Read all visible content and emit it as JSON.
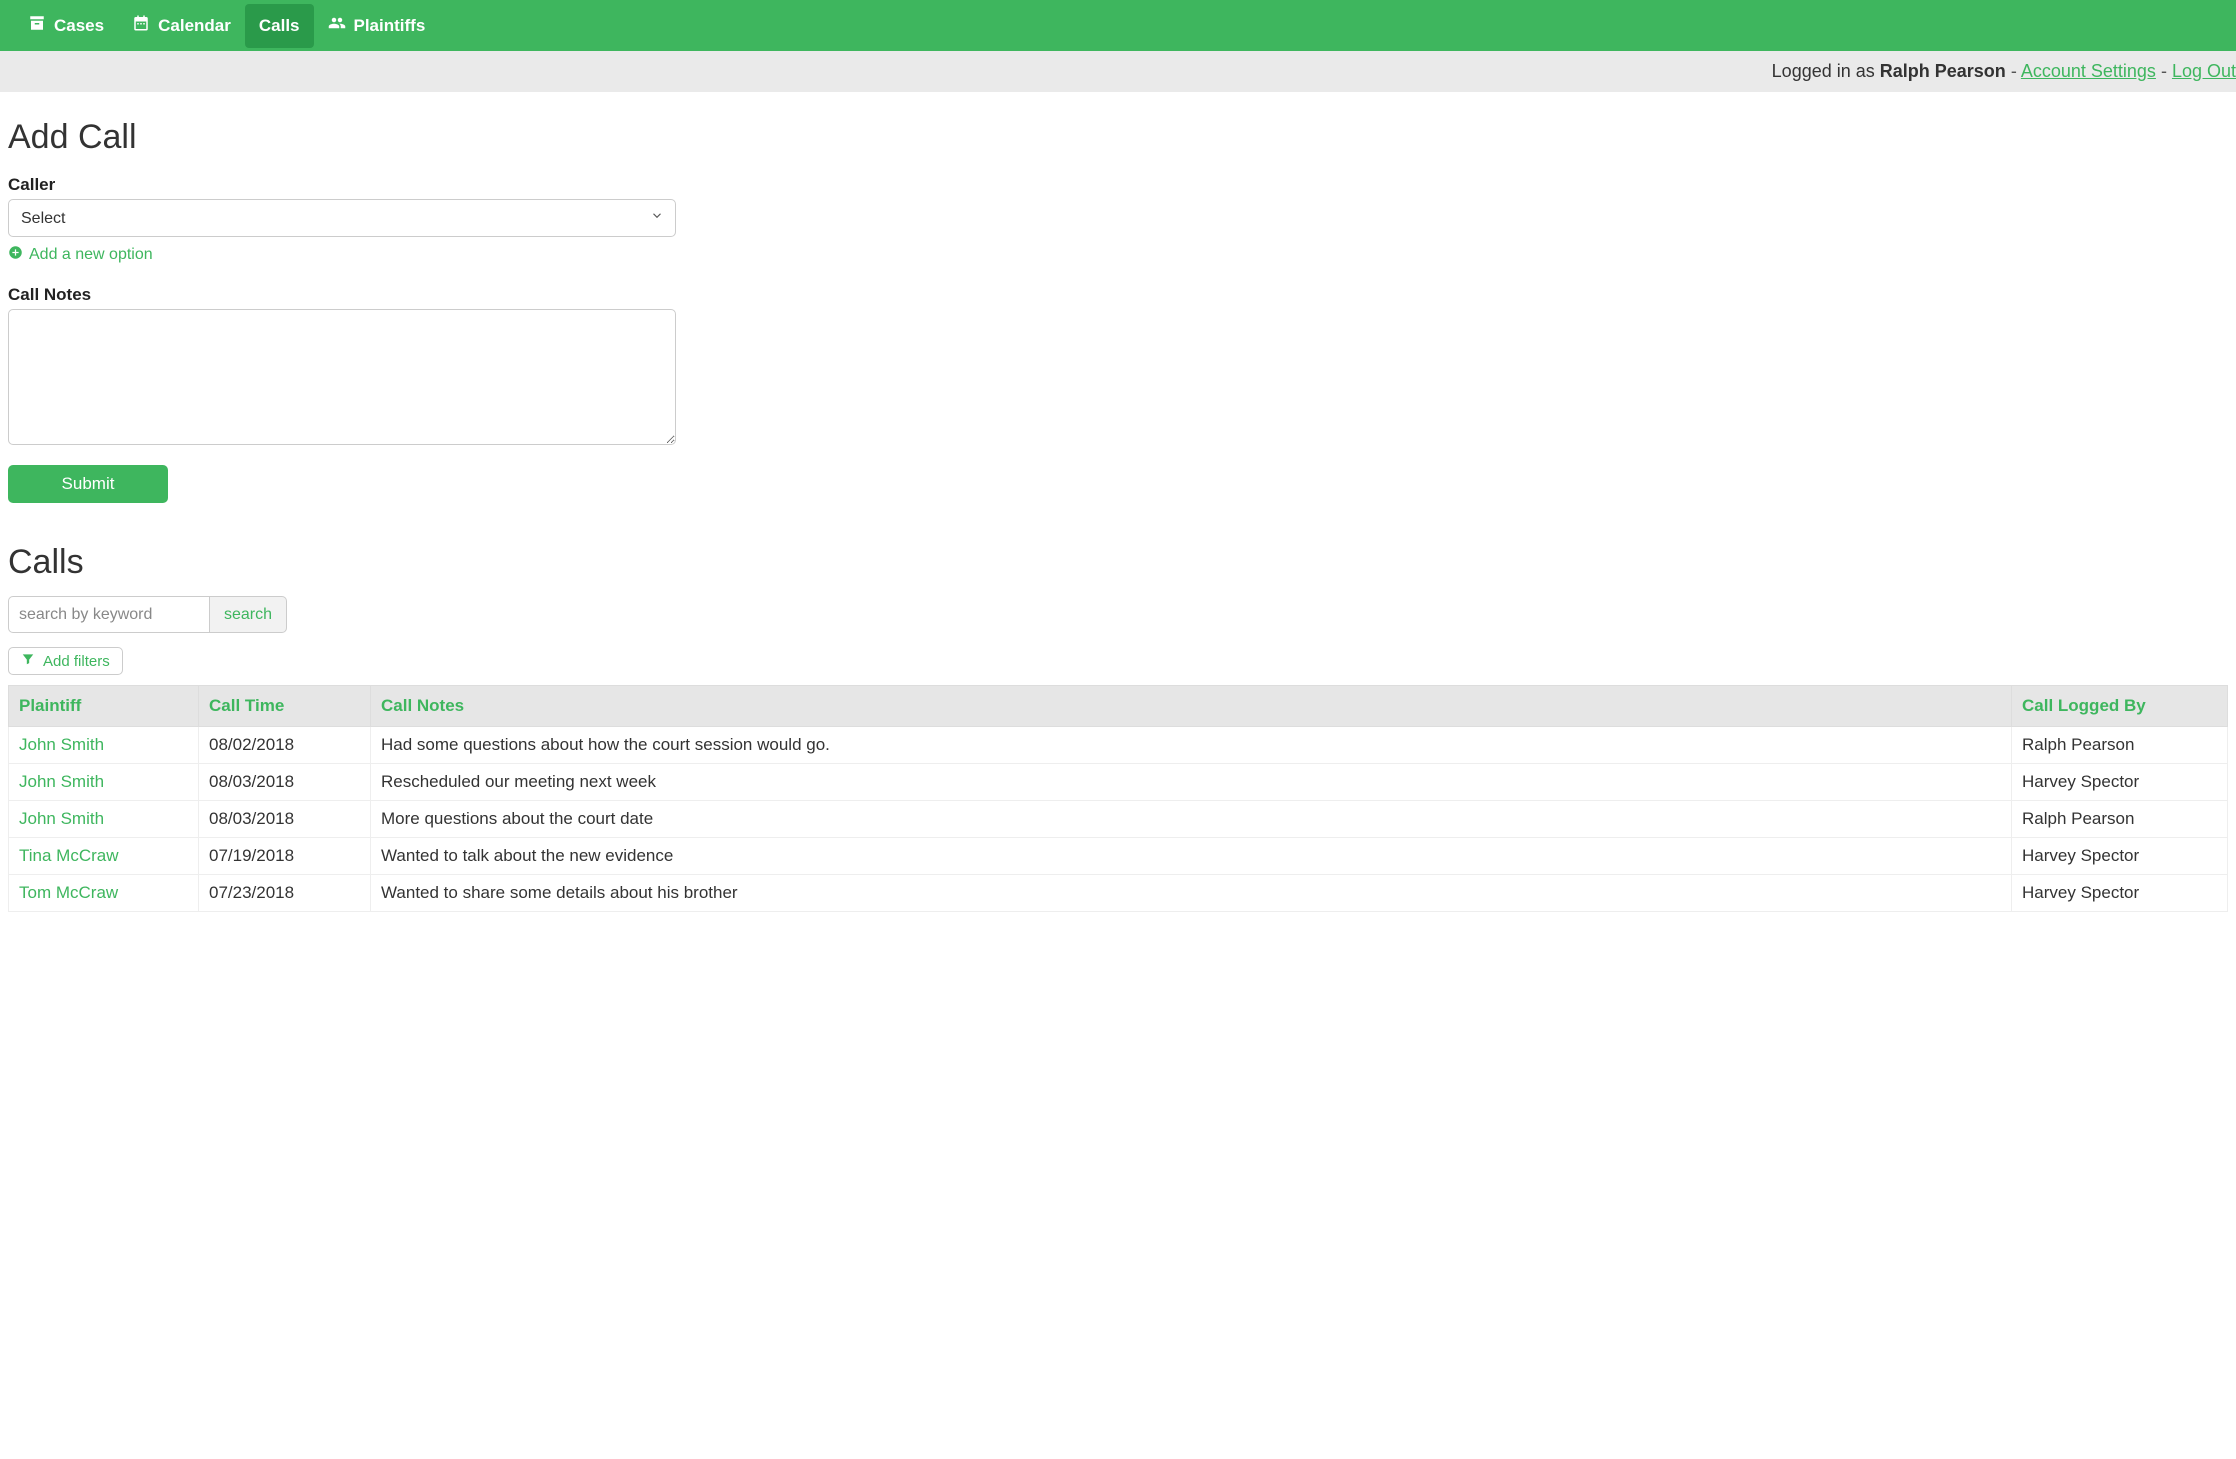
{
  "nav": {
    "items": [
      {
        "key": "cases",
        "label": "Cases",
        "icon": "archive"
      },
      {
        "key": "calendar",
        "label": "Calendar",
        "icon": "calendar"
      },
      {
        "key": "calls",
        "label": "Calls",
        "icon": "phone",
        "active": true
      },
      {
        "key": "plaintiffs",
        "label": "Plaintiffs",
        "icon": "users"
      }
    ]
  },
  "userbar": {
    "prefix": "Logged in as ",
    "user_name": "Ralph Pearson",
    "account_settings_label": "Account Settings",
    "logout_label": "Log Out",
    "separator": " - "
  },
  "form": {
    "title": "Add Call",
    "caller_label": "Caller",
    "caller_selected": "Select",
    "add_option_label": "Add a new option",
    "notes_label": "Call Notes",
    "notes_value": "",
    "submit_label": "Submit"
  },
  "list": {
    "title": "Calls",
    "search_placeholder": "search by keyword",
    "search_button": "search",
    "add_filters_label": "Add filters",
    "columns": {
      "plaintiff": "Plaintiff",
      "call_time": "Call Time",
      "call_notes": "Call Notes",
      "logged_by": "Call Logged By"
    },
    "rows": [
      {
        "plaintiff": "John Smith",
        "call_time": "08/02/2018",
        "call_notes": "Had some questions about how the court session would go.",
        "logged_by": "Ralph Pearson"
      },
      {
        "plaintiff": "John Smith",
        "call_time": "08/03/2018",
        "call_notes": "Rescheduled our meeting next week",
        "logged_by": "Harvey Spector"
      },
      {
        "plaintiff": "John Smith",
        "call_time": "08/03/2018",
        "call_notes": "More questions about the court date",
        "logged_by": "Ralph Pearson"
      },
      {
        "plaintiff": "Tina McCraw",
        "call_time": "07/19/2018",
        "call_notes": "Wanted to talk about the new evidence",
        "logged_by": "Harvey Spector"
      },
      {
        "plaintiff": "Tom McCraw",
        "call_time": "07/23/2018",
        "call_notes": "Wanted to share some details about his brother",
        "logged_by": "Harvey Spector"
      }
    ]
  }
}
